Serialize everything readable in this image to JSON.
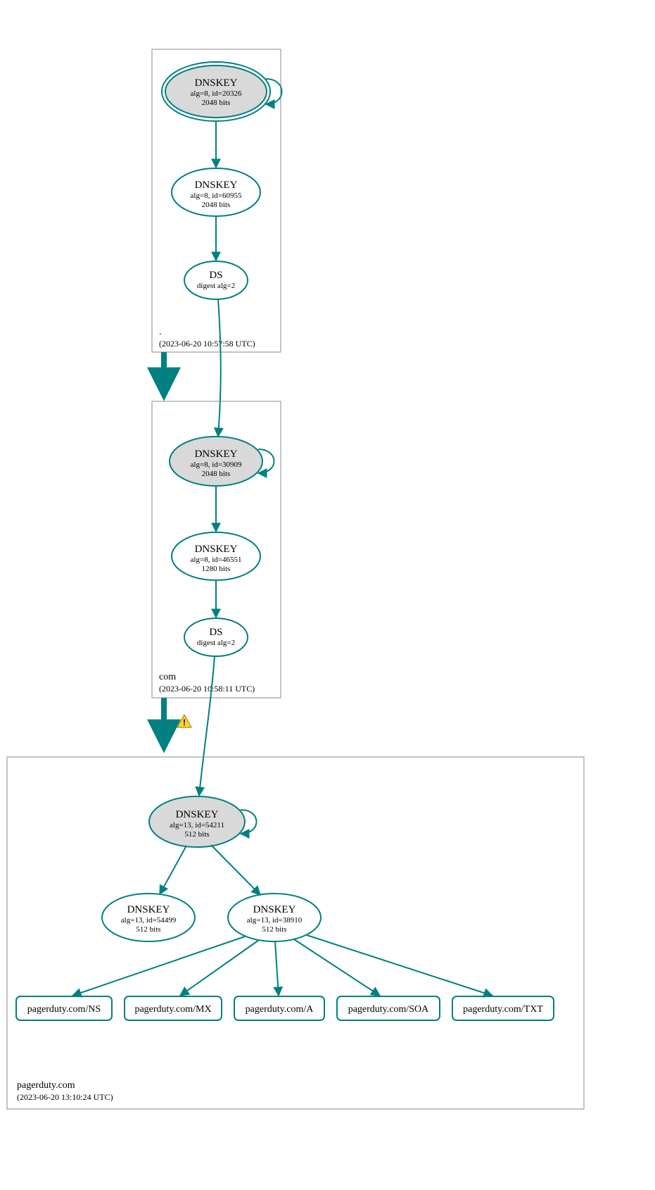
{
  "colors": {
    "teal": "#008080",
    "nodeFill": "#d9d9d9",
    "boxStroke": "#888888",
    "warnFill": "#ffd23d",
    "warnStroke": "#b58900",
    "white": "#ffffff"
  },
  "zones": {
    "root": {
      "name": ".",
      "timestamp": "(2023-06-20 10:57:58 UTC)"
    },
    "com": {
      "name": "com",
      "timestamp": "(2023-06-20 10:58:11 UTC)"
    },
    "domain": {
      "name": "pagerduty.com",
      "timestamp": "(2023-06-20 13:10:24 UTC)"
    }
  },
  "nodes": {
    "rootKSK": {
      "title": "DNSKEY",
      "line1": "alg=8, id=20326",
      "line2": "2048 bits"
    },
    "rootZSK": {
      "title": "DNSKEY",
      "line1": "alg=8, id=60955",
      "line2": "2048 bits"
    },
    "rootDS": {
      "title": "DS",
      "line1": "digest alg=2"
    },
    "comKSK": {
      "title": "DNSKEY",
      "line1": "alg=8, id=30909",
      "line2": "2048 bits"
    },
    "comZSK": {
      "title": "DNSKEY",
      "line1": "alg=8, id=46551",
      "line2": "1280 bits"
    },
    "comDS": {
      "title": "DS",
      "line1": "digest alg=2"
    },
    "domKSK": {
      "title": "DNSKEY",
      "line1": "alg=13, id=54211",
      "line2": "512 bits"
    },
    "domStand": {
      "title": "DNSKEY",
      "line1": "alg=13, id=54499",
      "line2": "512 bits"
    },
    "domZSK": {
      "title": "DNSKEY",
      "line1": "alg=13, id=38910",
      "line2": "512 bits"
    }
  },
  "records": {
    "ns": {
      "label": "pagerduty.com/NS"
    },
    "mx": {
      "label": "pagerduty.com/MX"
    },
    "a": {
      "label": "pagerduty.com/A"
    },
    "soa": {
      "label": "pagerduty.com/SOA"
    },
    "txt": {
      "label": "pagerduty.com/TXT"
    }
  },
  "warning": {
    "symbol": "!"
  }
}
